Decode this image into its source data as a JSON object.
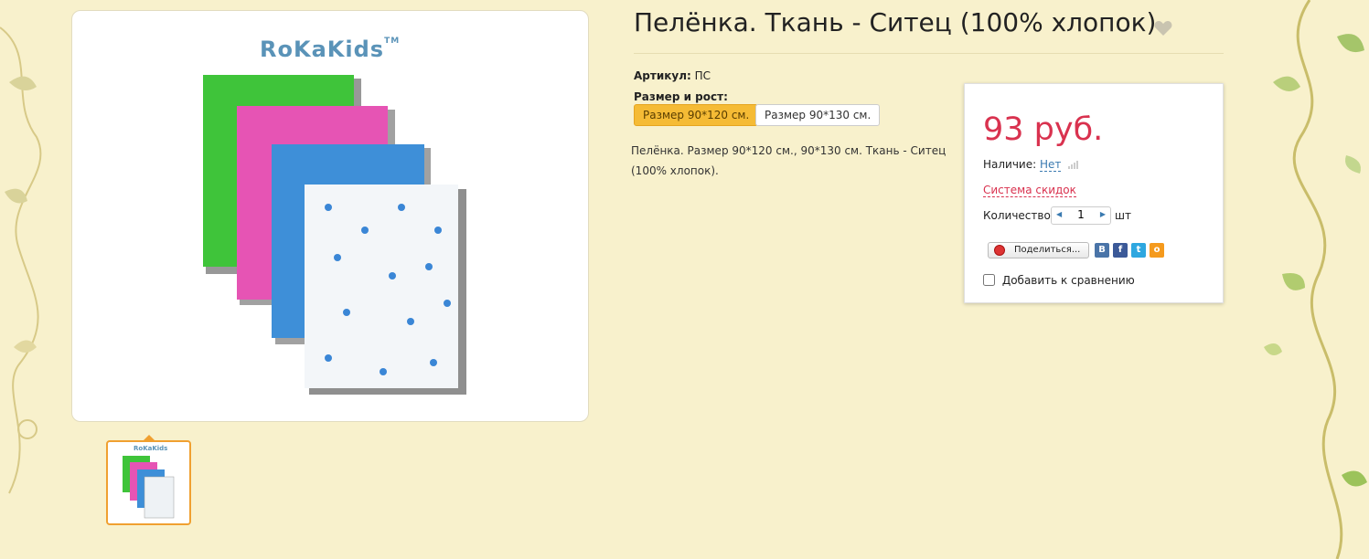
{
  "product": {
    "title": "Пелёнка. Ткань - Ситец (100% хлопок).",
    "sku_label": "Артикул:",
    "sku_value": "ПС",
    "size_label": "Размер и рост:",
    "sizes": [
      {
        "label": "Размер 90*120 см.",
        "selected": true
      },
      {
        "label": "Размер 90*130 см.",
        "selected": false
      }
    ],
    "description": "Пелёнка. Размер 90*120 см., 90*130 см. Ткань - Ситец (100% хлопок).",
    "brand": "RoKaKids",
    "brand_tm": "TM"
  },
  "buy_box": {
    "price": "93 руб.",
    "availability_label": "Наличие:",
    "availability_value": "Нет",
    "discount_link": "Система скидок",
    "quantity_label": "Количество:",
    "quantity_value": "1",
    "quantity_unit": "шт",
    "share_label": "Поделиться...",
    "social": [
      "vkontakte-icon",
      "facebook-icon",
      "twitter-icon",
      "odnoklassniki-icon"
    ],
    "compare_label": "Добавить к сравнению"
  },
  "colors": {
    "background": "#f8f1cc",
    "price": "#d9324f",
    "selected_size": "#f5bb35",
    "thumb_border": "#f0a030",
    "link": "#3a7ab0"
  }
}
